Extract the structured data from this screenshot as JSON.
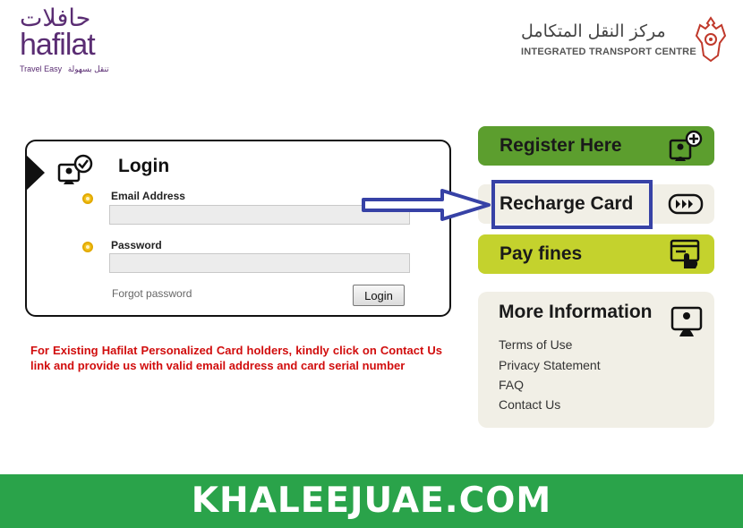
{
  "header": {
    "hafilat_logo": {
      "arabic": "حافلات",
      "latin": "hafilat",
      "tagline_en": "Travel Easy",
      "tagline_ar": "تنقل بسهولة",
      "color": "#5a2d73"
    },
    "itc_logo": {
      "arabic": "مركز النقل المتكامل",
      "english": "INTEGRATED TRANSPORT CENTRE"
    }
  },
  "login": {
    "title": "Login",
    "icon": "user-check-icon",
    "email_label": "Email Address",
    "email_value": "",
    "password_label": "Password",
    "password_value": "",
    "forgot_label": "Forgot password",
    "button_label": "Login",
    "bullet_color": "#f2c21c"
  },
  "notice": "For Existing Hafilat Personalized Card holders, kindly click on Contact Us link and provide us with valid email address and card serial number",
  "actions": {
    "register": {
      "label": "Register Here",
      "icon": "user-add-icon",
      "color": "#5c9e2e"
    },
    "recharge": {
      "label": "Recharge Card",
      "icon": "fast-forward-icon",
      "color": "#f1efe6",
      "highlight_color": "#3742a6"
    },
    "pay": {
      "label": "Pay fines",
      "icon": "card-hand-icon",
      "color": "#c4d22d"
    }
  },
  "more_info": {
    "title": "More Information",
    "icon": "info-person-icon",
    "links": [
      "Terms of Use",
      "Privacy Statement",
      "FAQ",
      "Contact Us"
    ]
  },
  "banner": {
    "text": "KHALEEJUAE.COM",
    "color": "#2aa34a"
  }
}
